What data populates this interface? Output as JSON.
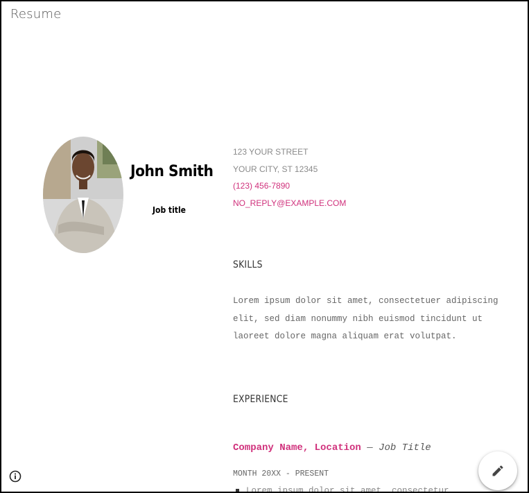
{
  "window": {
    "title": "Resume"
  },
  "profile": {
    "name": "John Smith",
    "job_title": "Job title"
  },
  "contact": {
    "street": "123 Your Street",
    "city": "Your City, ST 12345",
    "phone": "(123) 456-7890",
    "email": "no_reply@example.com"
  },
  "skills": {
    "heading": "SKILLS",
    "text": "Lorem ipsum dolor sit amet, consectetuer adipiscing elit, sed diam nonummy nibh euismod tincidunt ut laoreet dolore magna aliquam erat volutpat."
  },
  "experience": {
    "heading": "EXPERIENCE",
    "company": "Company Name, Location",
    "separator": " — ",
    "role": "Job Title",
    "dates": "Month 20XX - Present",
    "bullet": "Lorem ipsum dolor sit amet, consectetur"
  },
  "icons": {
    "info": "info-icon",
    "edit": "pencil-icon"
  },
  "colors": {
    "accent": "#d0317c",
    "muted": "#8a8a8a",
    "frame": "#000000"
  }
}
